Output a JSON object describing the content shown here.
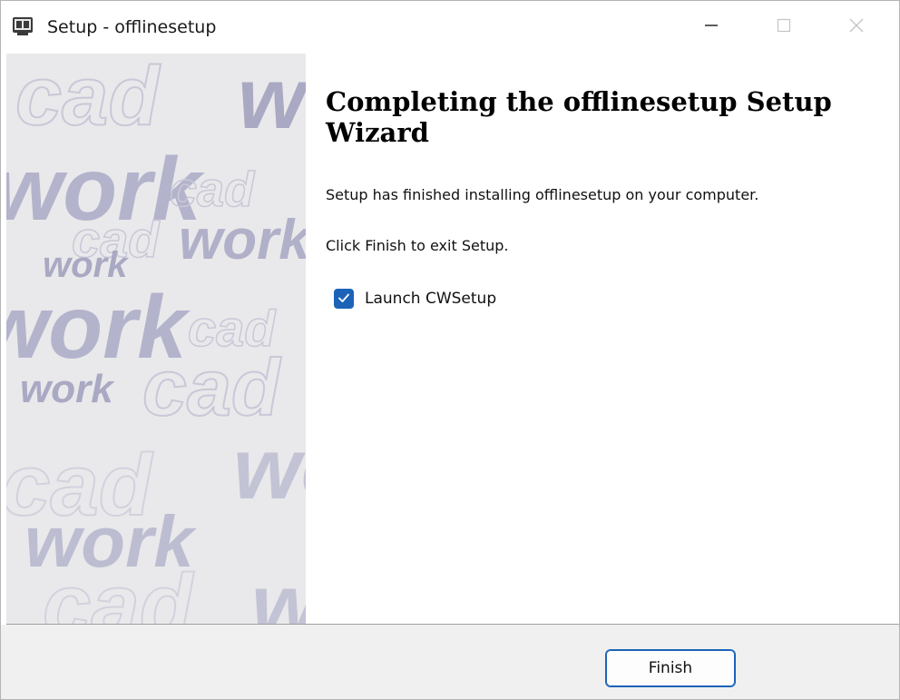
{
  "window": {
    "title": "Setup - offlinesetup",
    "icon": "setup-app-icon",
    "controls": [
      "minimize-icon",
      "maximize-icon",
      "close-icon"
    ]
  },
  "side_panel": {
    "watermark_text": [
      "cad",
      "work",
      "cad",
      "work",
      "cad",
      "work",
      "cad",
      "work",
      "cad",
      "work",
      "cad"
    ],
    "watermark_color": "#c8c8d8"
  },
  "content": {
    "heading": "Completing the offlinesetup Setup Wizard",
    "finished_text": "Setup has finished installing offlinesetup on your computer.",
    "exit_text": "Click Finish to exit Setup.",
    "launch_checkbox": {
      "label": "Launch CWSetup",
      "checked": true
    }
  },
  "footer": {
    "finish_label": "Finish"
  },
  "colors": {
    "accent": "#1c63b8",
    "footer_bg": "#f0f0f0",
    "side_bg": "#e9e9eb"
  }
}
